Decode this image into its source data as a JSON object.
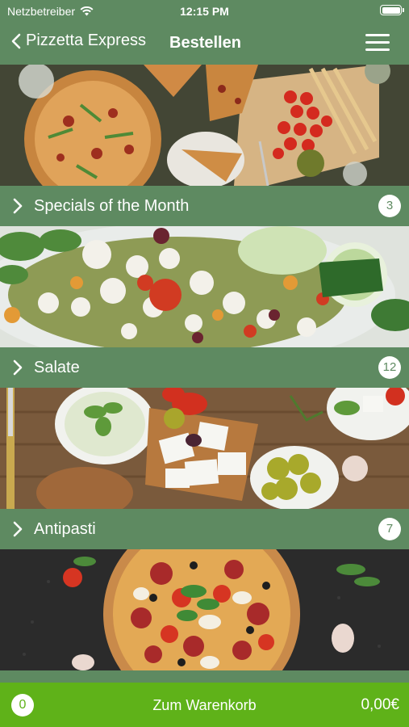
{
  "status": {
    "carrier": "Netzbetreiber",
    "time": "12:15 PM"
  },
  "nav": {
    "back_label": "Pizzetta Express",
    "title": "Bestellen"
  },
  "categories": [
    {
      "label": "Specials of the Month",
      "count": "3"
    },
    {
      "label": "Salate",
      "count": "12"
    },
    {
      "label": "Antipasti",
      "count": "7"
    }
  ],
  "cart": {
    "quantity": "0",
    "label": "Zum Warenkorb",
    "total": "0,00€"
  },
  "colors": {
    "header": "#5e8a61",
    "cart": "#5fb219"
  }
}
